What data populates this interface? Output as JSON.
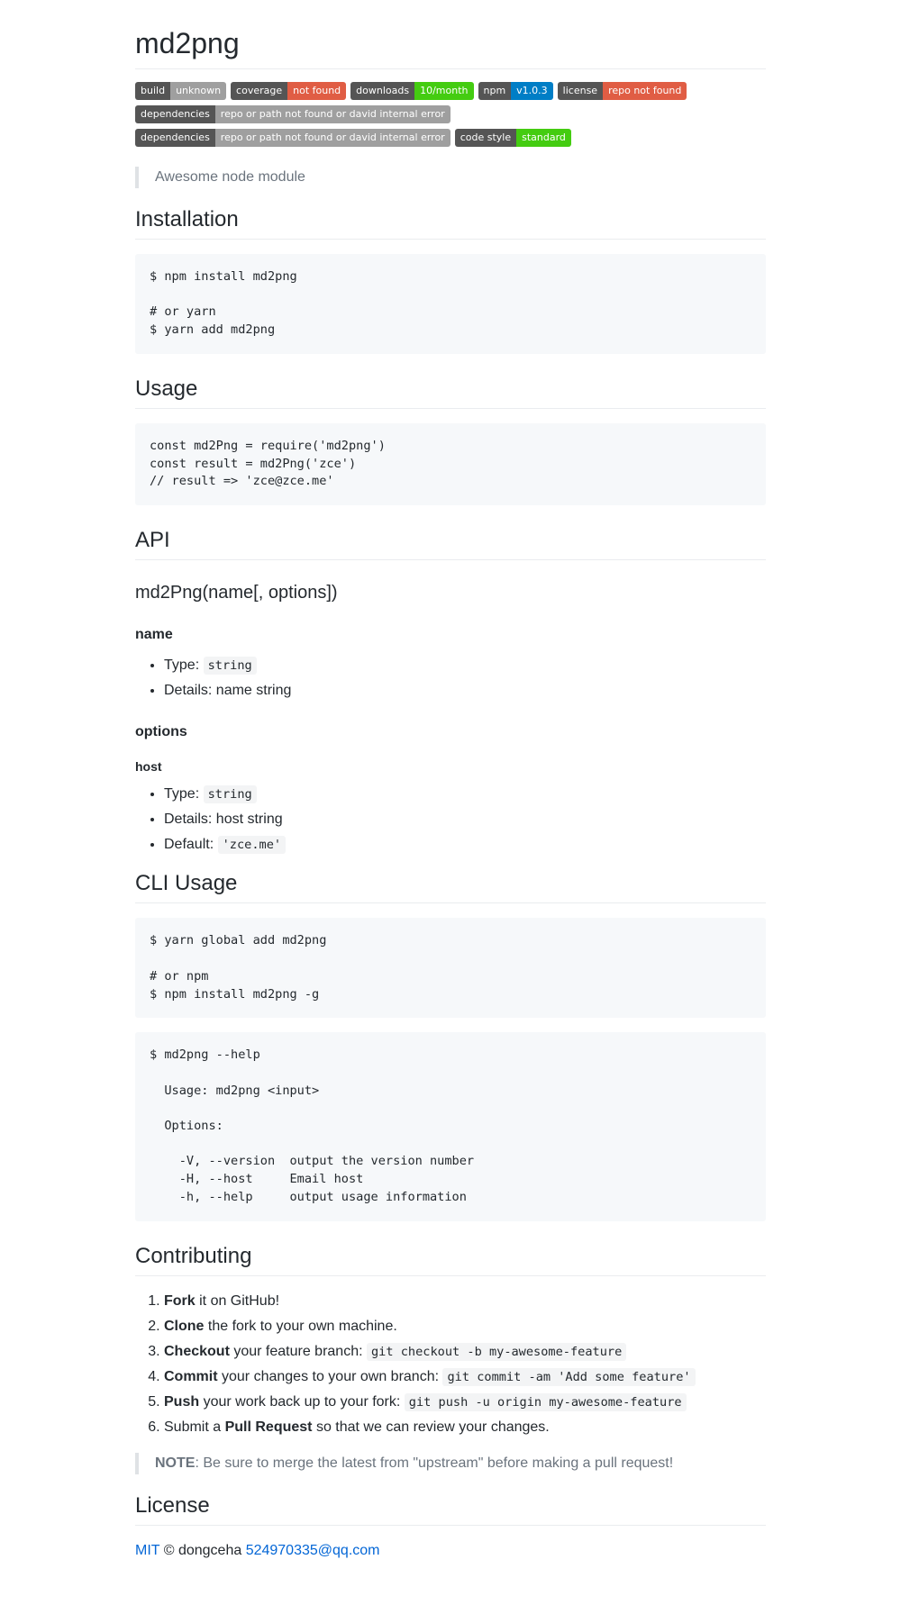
{
  "title": "md2png",
  "badges": [
    {
      "label": "build",
      "value": "unknown",
      "color": "#9f9f9f"
    },
    {
      "label": "coverage",
      "value": "not found",
      "color": "#e05d44"
    },
    {
      "label": "downloads",
      "value": "10/month",
      "color": "#4c1"
    },
    {
      "label": "npm",
      "value": "v1.0.3",
      "color": "#007ec6"
    },
    {
      "label": "license",
      "value": "repo not found",
      "color": "#e05d44"
    },
    {
      "label": "dependencies",
      "value": "repo or path not found or david internal error",
      "color": "#9f9f9f"
    },
    {
      "label": "dependencies",
      "value": "repo or path not found or david internal error",
      "color": "#9f9f9f"
    },
    {
      "label": "code style",
      "value": "standard",
      "color": "#4c1"
    }
  ],
  "tagline": "Awesome node module",
  "installation": {
    "heading": "Installation",
    "code": "$ npm install md2png\n\n# or yarn\n$ yarn add md2png"
  },
  "usage": {
    "heading": "Usage",
    "code": "const md2Png = require('md2png')\nconst result = md2Png('zce')\n// result => 'zce@zce.me'"
  },
  "api": {
    "heading": "API",
    "signature": "md2Png(name[, options])",
    "name": {
      "heading": "name",
      "type_label": "Type: ",
      "type_value": "string",
      "details": "Details: name string"
    },
    "options": {
      "heading": "options",
      "host": {
        "heading": "host",
        "type_label": "Type: ",
        "type_value": "string",
        "details": "Details: host string",
        "default_label": "Default: ",
        "default_value": "'zce.me'"
      }
    }
  },
  "cli": {
    "heading": "CLI Usage",
    "code_install": "$ yarn global add md2png\n\n# or npm\n$ npm install md2png -g",
    "code_help": "$ md2png --help\n\n  Usage: md2png <input>\n\n  Options:\n\n    -V, --version  output the version number\n    -H, --host     Email host\n    -h, --help     output usage information"
  },
  "contributing": {
    "heading": "Contributing",
    "steps": [
      {
        "bold": "Fork",
        "text": " it on GitHub!",
        "code": ""
      },
      {
        "bold": "Clone",
        "text": " the fork to your own machine.",
        "code": ""
      },
      {
        "bold": "Checkout",
        "text": " your feature branch: ",
        "code": "git checkout -b my-awesome-feature"
      },
      {
        "bold": "Commit",
        "text": " your changes to your own branch: ",
        "code": "git commit -am 'Add some feature'"
      },
      {
        "bold": "Push",
        "text": " your work back up to your fork: ",
        "code": "git push -u origin my-awesome-feature"
      }
    ],
    "last_step": {
      "pre": "Submit a ",
      "bold": "Pull Request",
      "post": " so that we can review your changes."
    },
    "note_bold": "NOTE",
    "note_text": ": Be sure to merge the latest from \"upstream\" before making a pull request!"
  },
  "license": {
    "heading": "License",
    "link": "MIT",
    "copy": " © dongceha ",
    "email": "524970335@qq.com"
  }
}
